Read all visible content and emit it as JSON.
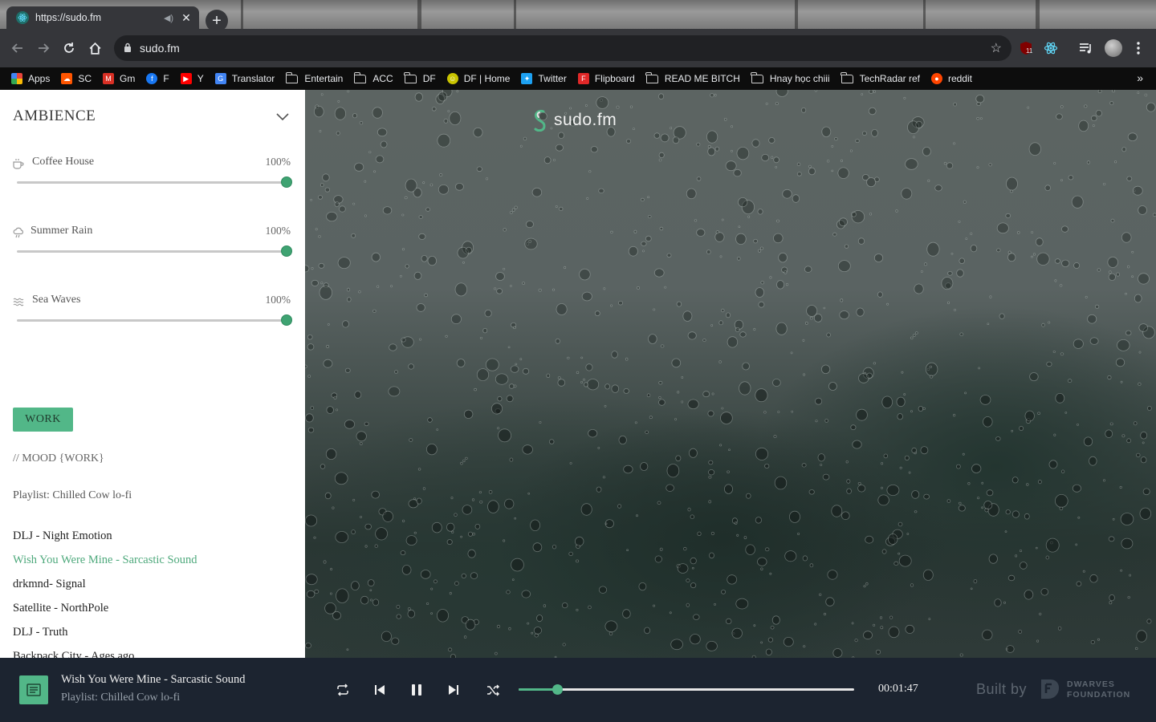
{
  "browser": {
    "tab_title": "https://sudo.fm",
    "url": "sudo.fm",
    "extension_badge": "11",
    "bookmarks": [
      {
        "label": "Apps",
        "icon": "apps-grid-icon",
        "color": "#e8453c"
      },
      {
        "label": "SC",
        "icon": "soundcloud-icon",
        "color": "#ff5500"
      },
      {
        "label": "Gm",
        "icon": "gmail-icon",
        "color": "#d93025"
      },
      {
        "label": "F",
        "icon": "facebook-icon",
        "color": "#1877f2"
      },
      {
        "label": "Y",
        "icon": "youtube-icon",
        "color": "#ff0000"
      },
      {
        "label": "Translator",
        "icon": "google-translate-icon",
        "color": "#4285f4"
      },
      {
        "label": "Entertain",
        "icon": "folder-icon"
      },
      {
        "label": "ACC",
        "icon": "folder-icon"
      },
      {
        "label": "DF",
        "icon": "folder-icon"
      },
      {
        "label": "DF | Home",
        "icon": "df-home-icon",
        "color": "#c9c400"
      },
      {
        "label": "Twitter",
        "icon": "twitter-icon",
        "color": "#1da1f2"
      },
      {
        "label": "Flipboard",
        "icon": "flipboard-icon",
        "color": "#e12828"
      },
      {
        "label": "READ ME BITCH",
        "icon": "folder-icon"
      },
      {
        "label": "Hnay học chiii",
        "icon": "folder-icon"
      },
      {
        "label": "TechRadar ref",
        "icon": "folder-icon"
      },
      {
        "label": "reddit",
        "icon": "reddit-icon",
        "color": "#ff4500"
      }
    ],
    "more_bookmarks": "»"
  },
  "sidebar": {
    "title": "AMBIENCE",
    "sounds": [
      {
        "name": "Coffee House",
        "volume_label": "100%",
        "volume": 1.0,
        "icon": "coffee-cup-icon"
      },
      {
        "name": "Summer Rain",
        "volume_label": "100%",
        "volume": 1.0,
        "icon": "rain-cloud-icon"
      },
      {
        "name": "Sea Waves",
        "volume_label": "100%",
        "volume": 1.0,
        "icon": "waves-icon"
      }
    ],
    "mood_button": "WORK",
    "mood_label": "// MOOD {WORK}",
    "playlist_label": "Playlist: Chilled Cow lo-fi",
    "songs": [
      {
        "title": "DLJ - Night Emotion",
        "active": false
      },
      {
        "title": "Wish You Were Mine - Sarcastic Sound",
        "active": true
      },
      {
        "title": "drkmnd- Signal",
        "active": false
      },
      {
        "title": "Satellite - NorthPole",
        "active": false
      },
      {
        "title": "DLJ - Truth",
        "active": false
      },
      {
        "title": "Backpack City - Ages ago",
        "active": false
      }
    ]
  },
  "main": {
    "logo_text": "sudo.fm"
  },
  "player": {
    "now_playing_title": "Wish You Were Mine - Sarcastic Sound",
    "now_playing_playlist": "Playlist: Chilled Cow lo-fi",
    "progress": 0.115,
    "elapsed": "00:01:47",
    "built_by": "Built by",
    "credit_line1": "DWARVES",
    "credit_line2": "FOUNDATION",
    "accent_color": "#52b788"
  }
}
